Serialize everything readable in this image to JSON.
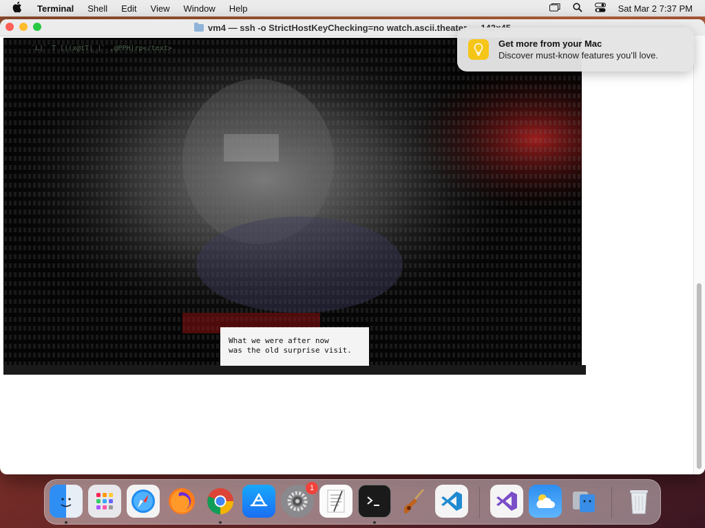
{
  "menubar": {
    "app_name": "Terminal",
    "items": [
      "Shell",
      "Edit",
      "View",
      "Window",
      "Help"
    ],
    "clock": "Sat Mar 2  7:37 PM"
  },
  "window": {
    "title": "vm4 — ssh -o StrictHostKeyChecking=no watch.ascii.theater — 142×45"
  },
  "terminal": {
    "subtitle_line1": "What we were after now",
    "subtitle_line2": "was the old surprise visit."
  },
  "notification": {
    "title": "Get more from your Mac",
    "body": "Discover must-know features you’ll love."
  },
  "dock": {
    "apps": [
      {
        "name": "Finder",
        "icon": "finder-icon",
        "running": true
      },
      {
        "name": "Launchpad",
        "icon": "launchpad-icon",
        "running": false
      },
      {
        "name": "Safari",
        "icon": "safari-icon",
        "running": false
      },
      {
        "name": "Firefox",
        "icon": "firefox-icon",
        "running": false
      },
      {
        "name": "Chrome",
        "icon": "chrome-icon",
        "running": true
      },
      {
        "name": "App Store",
        "icon": "app-store-icon",
        "running": false
      },
      {
        "name": "System Settings",
        "icon": "settings-icon",
        "running": false,
        "badge": "1"
      },
      {
        "name": "TextEdit",
        "icon": "textedit-icon",
        "running": false
      },
      {
        "name": "Terminal",
        "icon": "terminal-icon",
        "running": true
      },
      {
        "name": "Instruments",
        "icon": "instruments-icon",
        "running": false
      },
      {
        "name": "Visual Studio Code",
        "icon": "vscode-icon",
        "running": false
      },
      {
        "name": "Visual Studio",
        "icon": "visual-studio-icon",
        "running": false
      },
      {
        "name": "Weather",
        "icon": "weather-icon",
        "running": false
      },
      {
        "name": "Migration Assistant",
        "icon": "migration-icon",
        "running": false
      },
      {
        "name": "Trash",
        "icon": "trash-icon",
        "running": false
      }
    ]
  }
}
